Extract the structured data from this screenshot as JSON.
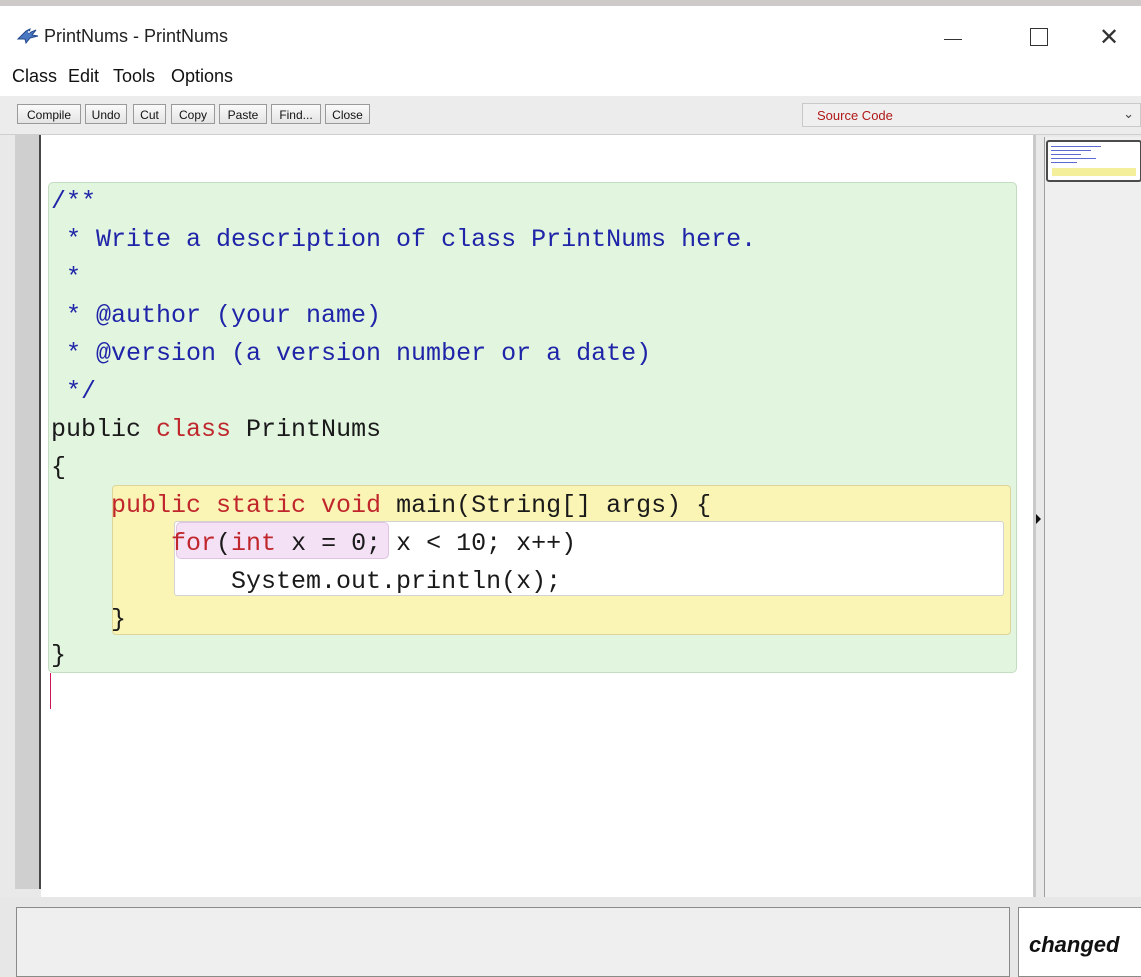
{
  "window": {
    "title": "PrintNums - PrintNums",
    "controls": {
      "minimize": "minimize",
      "maximize": "maximize",
      "close": "✕"
    }
  },
  "menu": {
    "items": [
      "Class",
      "Edit",
      "Tools",
      "Options"
    ]
  },
  "toolbar": {
    "buttons": [
      "Compile",
      "Undo",
      "Cut",
      "Copy",
      "Paste",
      "Find...",
      "Close"
    ],
    "view_selector": {
      "value": "Source Code",
      "color": "#b01818"
    }
  },
  "editor": {
    "lines": [
      [
        {
          "t": "/**",
          "s": "comment"
        }
      ],
      [
        {
          "t": " * Write a description of class PrintNums here.",
          "s": "comment"
        }
      ],
      [
        {
          "t": " *",
          "s": "comment"
        }
      ],
      [
        {
          "t": " * @author (your name)",
          "s": "comment"
        }
      ],
      [
        {
          "t": " * @version (a version number or a date)",
          "s": "comment"
        }
      ],
      [
        {
          "t": " */",
          "s": "comment"
        }
      ],
      [
        {
          "t": "public ",
          "s": "plain"
        },
        {
          "t": "class",
          "s": "kw"
        },
        {
          "t": " PrintNums",
          "s": "plain"
        }
      ],
      [
        {
          "t": "{",
          "s": "plain"
        }
      ],
      [
        {
          "t": "    public static ",
          "s": "kw"
        },
        {
          "t": "void",
          "s": "kw"
        },
        {
          "t": " main(String[] args) {",
          "s": "plain"
        }
      ],
      [
        {
          "t": "        for",
          "s": "kw"
        },
        {
          "t": "(",
          "s": "plain"
        },
        {
          "t": "int",
          "s": "kw"
        },
        {
          "t": " x = 0; x < 10; x++)",
          "s": "plain"
        }
      ],
      [
        {
          "t": "            System.out.println(x);",
          "s": "plain"
        }
      ],
      [
        {
          "t": "    }",
          "s": "plain"
        }
      ],
      [
        {
          "t": "}",
          "s": "plain"
        }
      ]
    ],
    "colors": {
      "comment": "#1f24a8",
      "keyword": "#c0272d",
      "class_scope": "#e1f5df",
      "method_scope": "#faf5b4",
      "for_scope": "#f5e1f6"
    }
  },
  "status": {
    "message": "",
    "changed_label": "changed"
  },
  "icons": {
    "app": "bluej-bird-icon",
    "caret": "text-caret"
  }
}
